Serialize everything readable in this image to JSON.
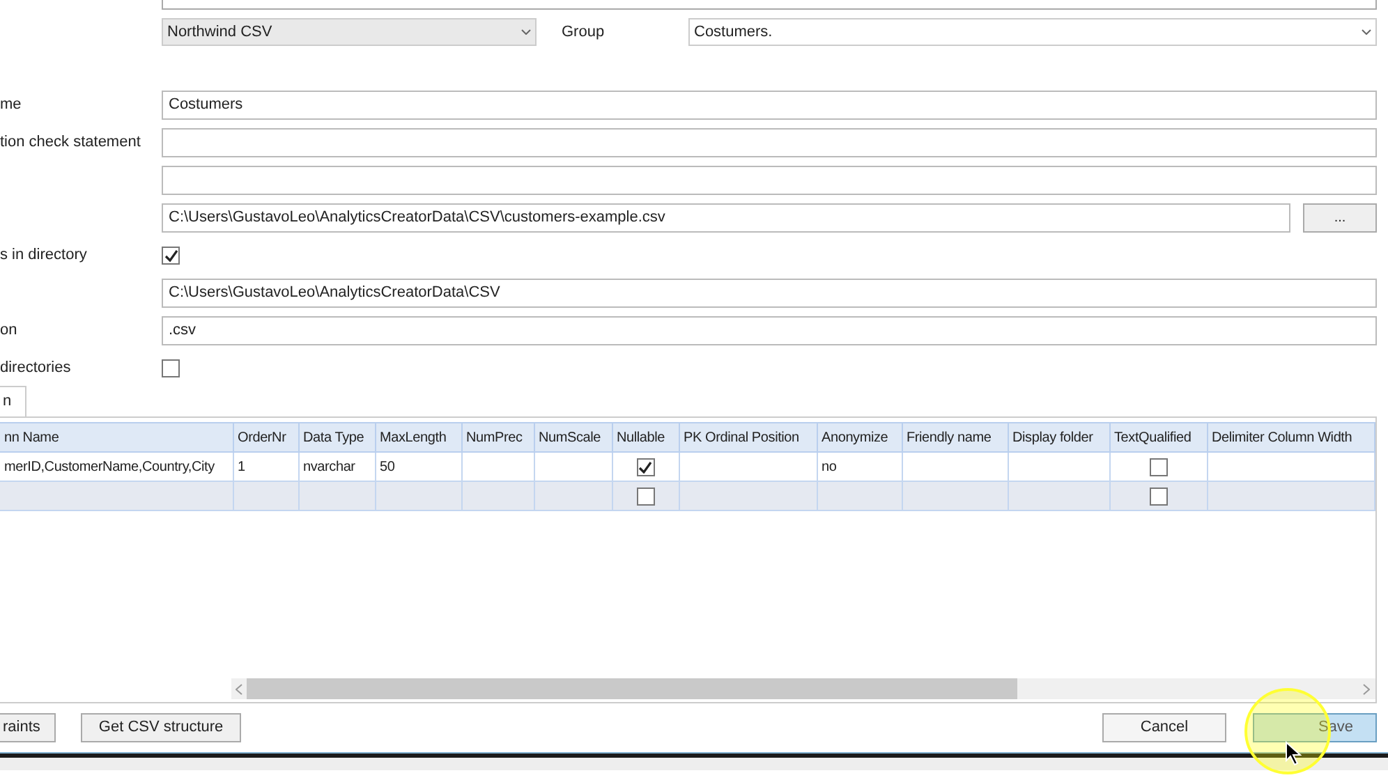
{
  "source": {
    "connection": "Northwind CSV",
    "group_label": "Group",
    "group": "Costumers."
  },
  "fields": [
    {
      "kind": "text",
      "label": "me",
      "value": "Costumers"
    },
    {
      "kind": "text",
      "label": "tion check statement"
    },
    {
      "kind": "text"
    },
    {
      "kind": "file",
      "value": "C:\\Users\\GustavoLeo\\AnalyticsCreatorData\\CSV\\customers-example.csv",
      "button": "..."
    },
    {
      "kind": "checkbox",
      "label": "s in directory",
      "checked": true
    },
    {
      "kind": "text",
      "value": "C:\\Users\\GustavoLeo\\AnalyticsCreatorData\\CSV"
    },
    {
      "kind": "text",
      "label": "on",
      "value": ".csv"
    },
    {
      "kind": "checkbox",
      "label": "directories",
      "checked": false
    }
  ],
  "tabs": [
    {
      "label": "n",
      "selected": true
    }
  ],
  "table": {
    "columns": [
      {
        "label": "nn Name",
        "kind": "text"
      },
      {
        "label": "OrderNr",
        "kind": "text"
      },
      {
        "label": "Data Type",
        "kind": "text"
      },
      {
        "label": "MaxLength",
        "kind": "text"
      },
      {
        "label": "NumPrec",
        "kind": "text"
      },
      {
        "label": "NumScale",
        "kind": "text"
      },
      {
        "label": "Nullable",
        "kind": "checkbox"
      },
      {
        "label": "PK Ordinal Position",
        "kind": "text"
      },
      {
        "label": "Anonymize",
        "kind": "text"
      },
      {
        "label": "Friendly name",
        "kind": "text"
      },
      {
        "label": "Display folder",
        "kind": "text"
      },
      {
        "label": "TextQualified",
        "kind": "checkbox"
      },
      {
        "label": "Delimiter Column Width",
        "kind": "text"
      }
    ],
    "rows": [
      {
        "selected": false,
        "cells": [
          "merID,CustomerName,Country,City",
          "1",
          "nvarchar",
          "50",
          null,
          null,
          true,
          null,
          "no",
          null,
          null,
          false,
          null
        ]
      },
      {
        "selected": true,
        "cells": [
          null,
          null,
          null,
          null,
          null,
          null,
          false,
          null,
          null,
          null,
          null,
          false,
          null
        ]
      }
    ]
  },
  "footer": {
    "left_buttons": [
      {
        "label": "raints"
      },
      {
        "label": "Get CSV structure"
      }
    ],
    "right_buttons": [
      {
        "label": "Cancel",
        "kind": "plain"
      },
      {
        "label": "Save",
        "kind": "primary"
      }
    ]
  }
}
